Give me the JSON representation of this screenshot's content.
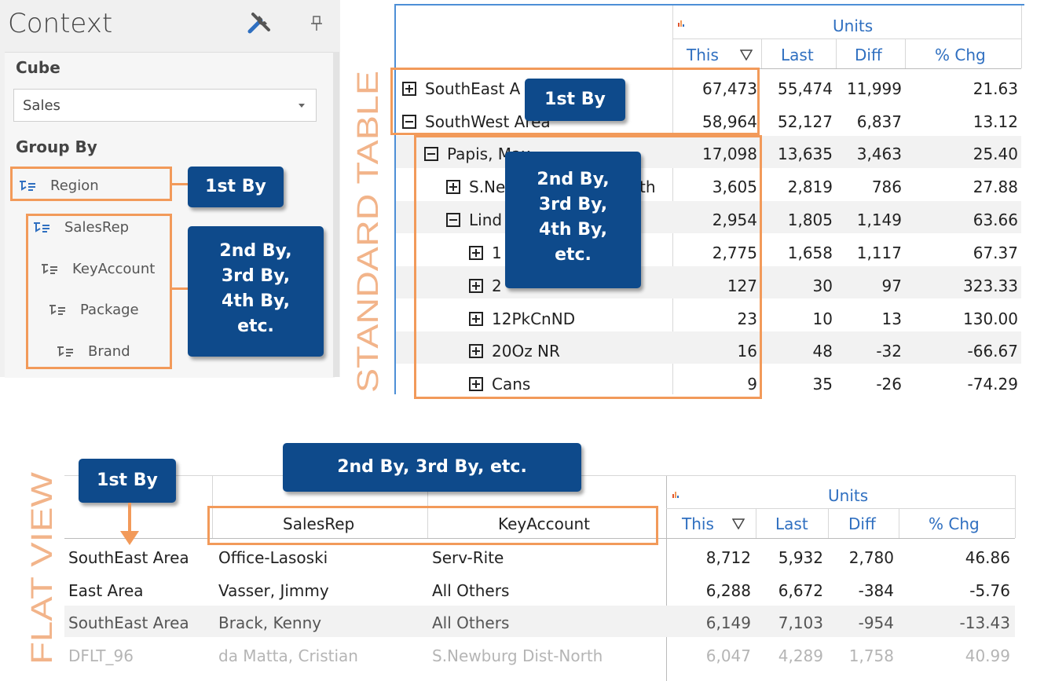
{
  "context_panel": {
    "title": "Context",
    "cube_label": "Cube",
    "cube_value": "Sales",
    "group_by_label": "Group By",
    "group_by_items": [
      "Region",
      "SalesRep",
      "KeyAccount",
      "Package",
      "Brand"
    ]
  },
  "callouts": {
    "ctx_first": "1st By",
    "ctx_rest": [
      "2nd By,",
      "3rd By,",
      "4th By,",
      "etc."
    ],
    "std_first": "1st By",
    "std_rest": [
      "2nd By,",
      "3rd By,",
      "4th By,",
      "etc."
    ],
    "flat_first": "1st By",
    "flat_rest": "2nd By, 3rd By, etc."
  },
  "vertical_labels": {
    "standard": "STANDARD TABLE",
    "flat": "FLAT VIEW"
  },
  "standard_table": {
    "group_header": "Units",
    "columns": [
      "This",
      "Last",
      "Diff",
      "% Chg"
    ],
    "rows": [
      {
        "label": "SouthEast A",
        "state": "plus",
        "this": "67,473",
        "last": "55,474",
        "diff": "11,999",
        "chg": "21.63"
      },
      {
        "label": "SouthWest Area",
        "state": "minus",
        "this": "58,964",
        "last": "52,127",
        "diff": "6,837",
        "chg": "13.12"
      },
      {
        "label": "Papis, Max",
        "state": "minus",
        "this": "17,098",
        "last": "13,635",
        "diff": "3,463",
        "chg": "25.40"
      },
      {
        "label": "S.Ne",
        "label_tail": "th",
        "state": "plus",
        "this": "3,605",
        "last": "2,819",
        "diff": "786",
        "chg": "27.88"
      },
      {
        "label": "Lind",
        "state": "minus",
        "this": "2,954",
        "last": "1,805",
        "diff": "1,149",
        "chg": "63.66"
      },
      {
        "label": "1",
        "state": "plus",
        "this": "2,775",
        "last": "1,658",
        "diff": "1,117",
        "chg": "67.37"
      },
      {
        "label": "2",
        "state": "plus",
        "this": "127",
        "last": "30",
        "diff": "97",
        "chg": "323.33"
      },
      {
        "label": "12PkCnND",
        "state": "plus",
        "this": "23",
        "last": "10",
        "diff": "13",
        "chg": "130.00"
      },
      {
        "label": "20Oz NR",
        "state": "plus",
        "this": "16",
        "last": "48",
        "diff": "-32",
        "chg": "-66.67"
      },
      {
        "label": "Cans",
        "state": "plus",
        "this": "9",
        "last": "35",
        "diff": "-26",
        "chg": "-74.29"
      }
    ]
  },
  "flat_view": {
    "dim_headers": [
      "SalesRep",
      "KeyAccount"
    ],
    "group_header": "Units",
    "columns": [
      "This",
      "Last",
      "Diff",
      "% Chg"
    ],
    "rows": [
      {
        "region": "SouthEast Area",
        "salesrep": "Office-Lasoski",
        "keyaccount": "Serv-Rite",
        "this": "8,712",
        "last": "5,932",
        "diff": "2,780",
        "chg": "46.86"
      },
      {
        "region": "East Area",
        "salesrep": "Vasser, Jimmy",
        "keyaccount": "All Others",
        "this": "6,288",
        "last": "6,672",
        "diff": "-384",
        "chg": "-5.76"
      },
      {
        "region": "SouthEast Area",
        "salesrep": "Brack, Kenny",
        "keyaccount": "All Others",
        "this": "6,149",
        "last": "7,103",
        "diff": "-954",
        "chg": "-13.43"
      },
      {
        "region": "DFLT_96",
        "salesrep": "da Matta, Cristian",
        "keyaccount": "S.Newburg Dist-North",
        "this": "6,047",
        "last": "4,289",
        "diff": "1,758",
        "chg": "40.99"
      }
    ]
  },
  "colors": {
    "callout_bg": "#0e4a8b",
    "highlight_orange": "#f29a5a",
    "header_blue": "#2f6fc0"
  }
}
